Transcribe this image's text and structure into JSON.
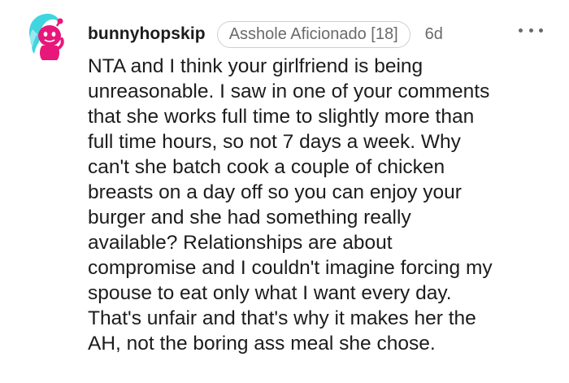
{
  "comment": {
    "username": "bunnyhopskip",
    "flair": "Asshole Aficionado [18]",
    "age": "6d",
    "more_icon": "more-horizontal-icon",
    "avatar_icon": "snoo-avatar-icon",
    "body_lines": [
      "NTA and I think your girlfriend is being",
      "unreasonable. I saw in one of your comments",
      "that she works full time to slightly more than",
      "full time hours, so not 7 days a week. Why",
      "can't she batch cook a couple of chicken",
      "breasts on a day off so you can enjoy your",
      "burger and she had something really",
      "available? Relationships are about",
      "compromise and I couldn't imagine forcing my",
      "spouse to eat only what I want every day.",
      "That's unfair and that's why it makes her the",
      "AH, not the boring ass meal she chose."
    ]
  },
  "colors": {
    "avatar_pink": "#e8177a",
    "avatar_hair": "#3fd6e0",
    "text": "#1c1c1c",
    "meta": "#6a6a6a"
  }
}
